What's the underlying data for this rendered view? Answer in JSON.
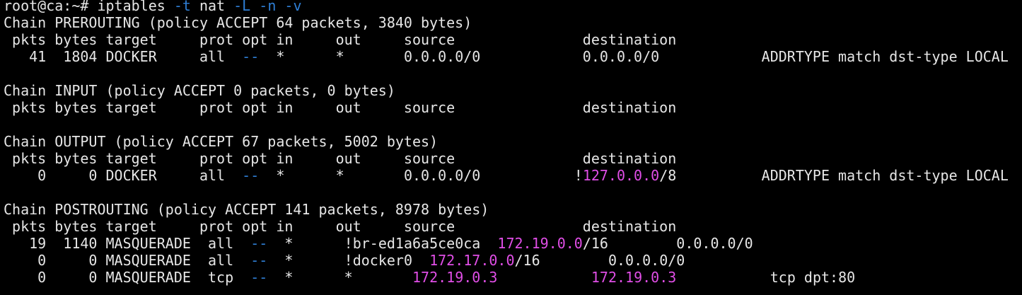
{
  "terminal": {
    "background": "#000000",
    "colors": {
      "default": "#e6e6e6",
      "blue": "#2f7fd6",
      "magenta": "#e04ee6"
    },
    "lines": [
      [
        {
          "t": "root@ca:~# iptables ",
          "c": "default"
        },
        {
          "t": "-t",
          "c": "blue"
        },
        {
          "t": " nat ",
          "c": "default"
        },
        {
          "t": "-L",
          "c": "blue"
        },
        {
          "t": " ",
          "c": "default"
        },
        {
          "t": "-n",
          "c": "blue"
        },
        {
          "t": " ",
          "c": "default"
        },
        {
          "t": "-v",
          "c": "blue"
        }
      ],
      [
        {
          "t": "Chain PREROUTING (policy ACCEPT 64 packets, 3840 bytes)",
          "c": "default"
        }
      ],
      [
        {
          "t": " pkts bytes target     prot opt in     out     source               destination",
          "c": "default"
        }
      ],
      [
        {
          "t": "   41  1804 DOCKER     all  ",
          "c": "default"
        },
        {
          "t": "--",
          "c": "blue"
        },
        {
          "t": "  *      *       0.0.0.0/0            0.0.0.0/0            ADDRTYPE match dst-type LOCAL",
          "c": "default"
        }
      ],
      [],
      [
        {
          "t": "Chain INPUT (policy ACCEPT 0 packets, 0 bytes)",
          "c": "default"
        }
      ],
      [
        {
          "t": " pkts bytes target     prot opt in     out     source               destination",
          "c": "default"
        }
      ],
      [],
      [
        {
          "t": "Chain OUTPUT (policy ACCEPT 67 packets, 5002 bytes)",
          "c": "default"
        }
      ],
      [
        {
          "t": " pkts bytes target     prot opt in     out     source               destination",
          "c": "default"
        }
      ],
      [
        {
          "t": "    0     0 DOCKER     all  ",
          "c": "default"
        },
        {
          "t": "--",
          "c": "blue"
        },
        {
          "t": "  *      *       0.0.0.0/0           !",
          "c": "default"
        },
        {
          "t": "127.0.0.0",
          "c": "magenta"
        },
        {
          "t": "/8          ADDRTYPE match dst-type LOCAL",
          "c": "default"
        }
      ],
      [],
      [
        {
          "t": "Chain POSTROUTING (policy ACCEPT 141 packets, 8978 bytes)",
          "c": "default"
        }
      ],
      [
        {
          "t": " pkts bytes target     prot opt in     out     source               destination",
          "c": "default"
        }
      ],
      [
        {
          "t": "   19  1140 MASQUERADE  all  ",
          "c": "default"
        },
        {
          "t": "--",
          "c": "blue"
        },
        {
          "t": "  *      !br-ed1a6a5ce0ca  ",
          "c": "default"
        },
        {
          "t": "172.19.0.0",
          "c": "magenta"
        },
        {
          "t": "/16        0.0.0.0/0",
          "c": "default"
        }
      ],
      [
        {
          "t": "    0     0 MASQUERADE  all  ",
          "c": "default"
        },
        {
          "t": "--",
          "c": "blue"
        },
        {
          "t": "  *      !docker0  ",
          "c": "default"
        },
        {
          "t": "172.17.0.0",
          "c": "magenta"
        },
        {
          "t": "/16        0.0.0.0/0",
          "c": "default"
        }
      ],
      [
        {
          "t": "    0     0 MASQUERADE  tcp  ",
          "c": "default"
        },
        {
          "t": "--",
          "c": "blue"
        },
        {
          "t": "  *      *       ",
          "c": "default"
        },
        {
          "t": "172.19.0.3",
          "c": "magenta"
        },
        {
          "t": "           ",
          "c": "default"
        },
        {
          "t": "172.19.0.3",
          "c": "magenta"
        },
        {
          "t": "           tcp dpt:80",
          "c": "default"
        }
      ]
    ]
  }
}
